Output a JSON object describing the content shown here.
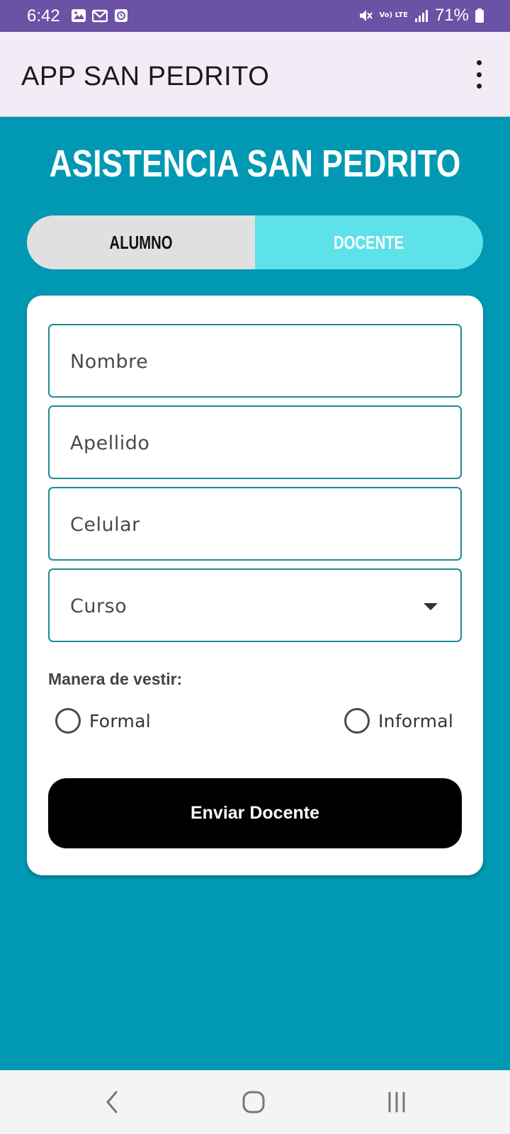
{
  "status_bar": {
    "time": "6:42",
    "battery_percent": "71%",
    "lte_label": "Vo) LTE",
    "icons_left": [
      "image-icon",
      "gmail-icon",
      "app-notification-icon"
    ],
    "icons_right": [
      "mute-icon",
      "volte-icon",
      "signal-icon",
      "battery-icon"
    ]
  },
  "app_bar": {
    "title": "APP SAN PEDRITO",
    "menu_icon": "more-vert-icon"
  },
  "heading": "ASISTENCIA SAN PEDRITO",
  "toggle": {
    "options": [
      "ALUMNO",
      "DOCENTE"
    ],
    "selected": "DOCENTE"
  },
  "form": {
    "nombre_placeholder": "Nombre",
    "apellido_placeholder": "Apellido",
    "celular_placeholder": "Celular",
    "curso_placeholder": "Curso",
    "manera_label": "Manera de vestir:",
    "radio_formal": "Formal",
    "radio_informal": "Informal",
    "submit_label": "Enviar Docente"
  },
  "nav_bar": {
    "buttons": [
      "back-icon",
      "home-icon",
      "recents-icon"
    ]
  },
  "colors": {
    "status_bar": "#6b52a4",
    "app_bar": "#f3ecf7",
    "background": "#0098b3",
    "toggle_inactive": "#e0e0e0",
    "toggle_active": "#5ce2e8",
    "field_border": "#1f8a96",
    "submit_button": "#000000"
  }
}
